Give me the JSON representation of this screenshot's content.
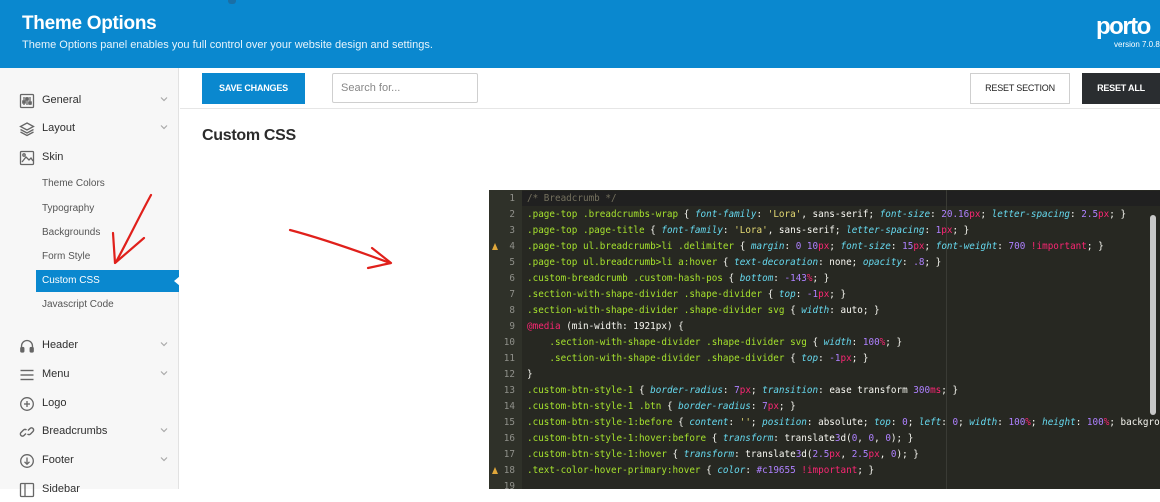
{
  "header": {
    "title": "Theme Options",
    "subtitle": "Theme Options panel enables you full control over your website design and settings.",
    "logo": "porto",
    "version": "version 7.0.8"
  },
  "sidebar": {
    "items": [
      {
        "label": "General",
        "icon": "sliders-icon"
      },
      {
        "label": "Layout",
        "icon": "layers-icon"
      },
      {
        "label": "Skin",
        "icon": "image-icon"
      },
      {
        "label": "Header",
        "icon": "headphones-icon"
      },
      {
        "label": "Menu",
        "icon": "menu-icon"
      },
      {
        "label": "Logo",
        "icon": "plus-circle-icon"
      },
      {
        "label": "Breadcrumbs",
        "icon": "link-icon"
      },
      {
        "label": "Footer",
        "icon": "arrow-down-circle-icon"
      },
      {
        "label": "Sidebar",
        "icon": "sidebar-icon"
      }
    ],
    "skin_subitems": [
      "Theme Colors",
      "Typography",
      "Backgrounds",
      "Form Style",
      "Custom CSS",
      "Javascript Code"
    ],
    "active_subitem": "Custom CSS"
  },
  "toolbar": {
    "save_label": "SAVE CHANGES",
    "search_placeholder": "Search for...",
    "reset_section_label": "RESET SECTION",
    "reset_all_label": "RESET ALL"
  },
  "section_title": "Custom CSS",
  "editor": {
    "lines": [
      {
        "n": "1",
        "warn": false,
        "code": "/* Breadcrumb */"
      },
      {
        "n": "2",
        "warn": false,
        "code": ".page-top .breadcrumbs-wrap { font-family: 'Lora', sans-serif; font-size: 20.16px; letter-spacing: 2.5px; }"
      },
      {
        "n": "3",
        "warn": false,
        "code": ".page-top .page-title { font-family: 'Lora', sans-serif; letter-spacing: 1px; }"
      },
      {
        "n": "4",
        "warn": true,
        "code": ".page-top ul.breadcrumb>li .delimiter { margin: 0 10px; font-size: 15px; font-weight: 700 !important; }"
      },
      {
        "n": "5",
        "warn": false,
        "code": ".page-top ul.breadcrumb>li a:hover { text-decoration: none; opacity: .8; }"
      },
      {
        "n": "6",
        "warn": false,
        "code": ".custom-breadcrumb .custom-hash-pos { bottom: -143%; }"
      },
      {
        "n": "7",
        "warn": false,
        "code": ".section-with-shape-divider .shape-divider { top: -1px; }"
      },
      {
        "n": "8",
        "warn": false,
        "code": ".section-with-shape-divider .shape-divider svg { width: auto; }"
      },
      {
        "n": "9",
        "warn": false,
        "code": "@media (min-width: 1921px) {"
      },
      {
        "n": "10",
        "warn": false,
        "code": "    .section-with-shape-divider .shape-divider svg { width: 100%; }"
      },
      {
        "n": "11",
        "warn": false,
        "code": "    .section-with-shape-divider .shape-divider { top: -1px; }"
      },
      {
        "n": "12",
        "warn": false,
        "code": "}"
      },
      {
        "n": "13",
        "warn": false,
        "code": ".custom-btn-style-1 { border-radius: 7px; transition: ease transform 300ms; }"
      },
      {
        "n": "14",
        "warn": false,
        "code": ".custom-btn-style-1 .btn { border-radius: 7px; }"
      },
      {
        "n": "15",
        "warn": false,
        "code": ".custom-btn-style-1:before { content: ''; position: absolute; top: 0; left: 0; width: 100%; height: 100%; background"
      },
      {
        "n": "16",
        "warn": false,
        "code": ".custom-btn-style-1:hover:before { transform: translate3d(0, 0, 0); }"
      },
      {
        "n": "17",
        "warn": false,
        "code": ".custom-btn-style-1:hover { transform: translate3d(2.5px, 2.5px, 0); }"
      },
      {
        "n": "18",
        "warn": true,
        "code": ".text-color-hover-primary:hover { color: #c19655 !important; }"
      },
      {
        "n": "19",
        "warn": false,
        "code": ""
      }
    ]
  },
  "colors": {
    "brand": "#0a88cf",
    "dark_button": "#2a2d30",
    "editor_bg": "#272822",
    "annotation": "#e0201b"
  }
}
